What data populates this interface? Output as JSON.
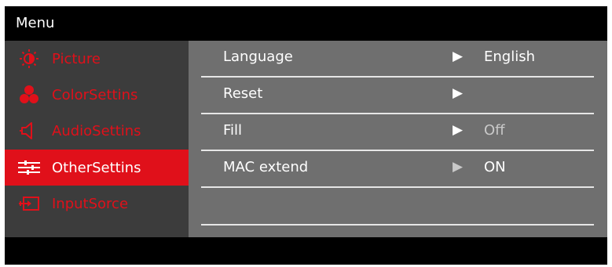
{
  "menu": {
    "title": "Menu"
  },
  "sidebar": {
    "items": [
      {
        "label": "Picture",
        "icon": "brightness-icon"
      },
      {
        "label": "ColorSettins",
        "icon": "color-circles-icon"
      },
      {
        "label": "AudioSettins",
        "icon": "speaker-icon"
      },
      {
        "label": "OtherSettins",
        "icon": "sliders-icon"
      },
      {
        "label": "InputSorce",
        "icon": "input-source-icon"
      }
    ],
    "active": "OtherSettins"
  },
  "settings": {
    "rows": [
      {
        "label": "Language",
        "arrow": "▶",
        "value": "English"
      },
      {
        "label": "Reset",
        "arrow": "▶",
        "value": ""
      },
      {
        "label": "Fill",
        "arrow": "▶",
        "value": "Off"
      },
      {
        "label": "MAC extend",
        "arrow": "▶",
        "value": "ON"
      }
    ]
  },
  "colors": {
    "accent": "#e0101a",
    "sidebar_bg": "#3c3c3c",
    "panel_bg": "#6f6f6f",
    "frame": "#000000"
  }
}
